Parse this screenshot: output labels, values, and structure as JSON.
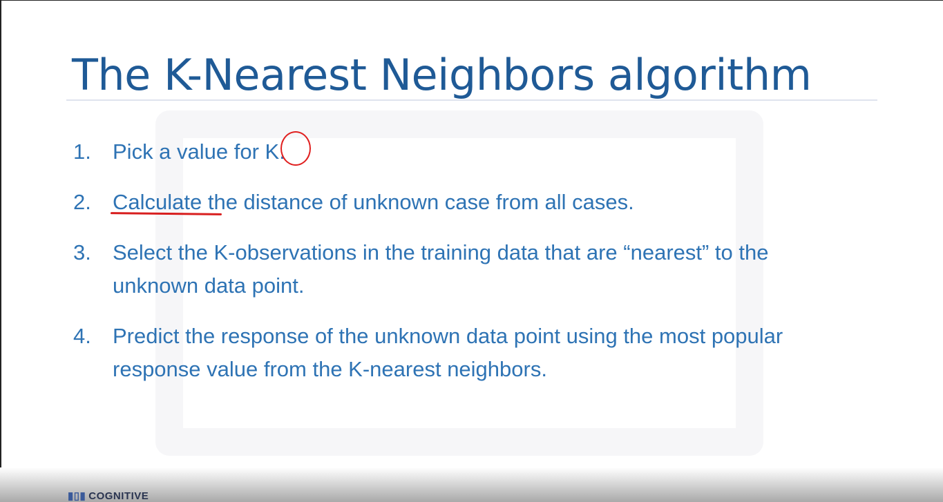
{
  "slide": {
    "title": "The K-Nearest Neighbors algorithm",
    "items": [
      {
        "num": "1.",
        "text": "Pick a value for K."
      },
      {
        "num": "2.",
        "text": "Calculate the distance of unknown case from all cases."
      },
      {
        "num": "3.",
        "text": "Select the K-observations in the training data that are “nearest” to the unknown data point."
      },
      {
        "num": "4.",
        "text": "Predict the response of the unknown data point using the most popular response value from the K-nearest neighbors."
      }
    ]
  },
  "footer": {
    "logo_text": "COGNITIVE"
  },
  "colors": {
    "title": "#1f5a96",
    "body": "#2e73b4",
    "annotation": "#e02020"
  }
}
